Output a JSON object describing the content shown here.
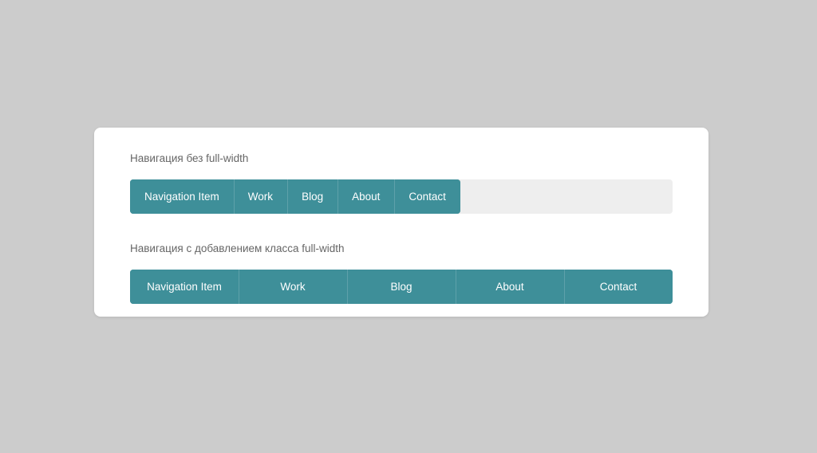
{
  "page": {
    "background_color": "#cccccc",
    "card_background": "#ffffff"
  },
  "theme": {
    "accent_color": "#3e8f99",
    "panel_color": "#eeeeee",
    "caption_color": "#666666",
    "item_label_color": "#ffffff",
    "divider_color": "rgba(255,255,255,0.17)"
  },
  "sections": [
    {
      "caption": "Навигация без full-width",
      "nav_mode": "inline",
      "items": [
        {
          "label": "Navigation Item"
        },
        {
          "label": "Work"
        },
        {
          "label": "Blog"
        },
        {
          "label": "About"
        },
        {
          "label": "Contact"
        }
      ]
    },
    {
      "caption": "Навигация с добавлением класса full-width",
      "nav_mode": "full-width",
      "items": [
        {
          "label": "Navigation Item"
        },
        {
          "label": "Work"
        },
        {
          "label": "Blog"
        },
        {
          "label": "About"
        },
        {
          "label": "Contact"
        }
      ]
    }
  ]
}
